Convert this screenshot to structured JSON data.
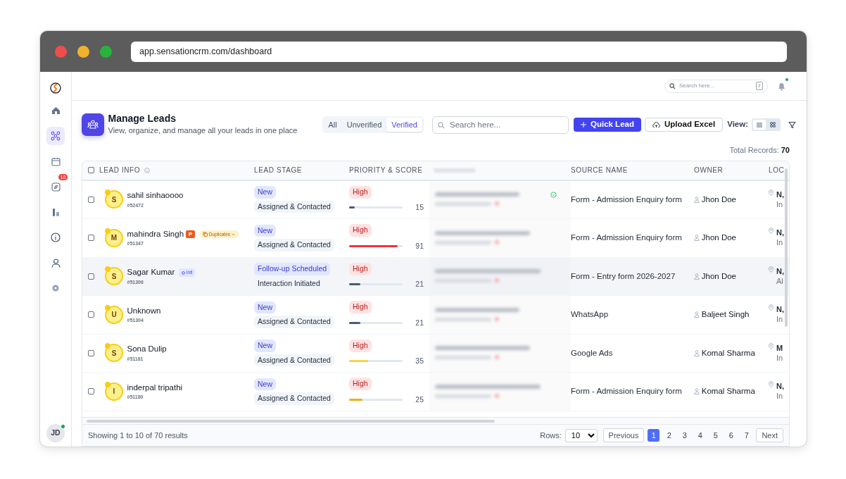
{
  "browser": {
    "url": "app.sensationcrm.com/dashboard"
  },
  "sidebar": {
    "items": [
      {
        "selected": false
      },
      {
        "selected": true
      },
      {
        "selected": false
      },
      {
        "selected": false,
        "badge": "10"
      },
      {
        "selected": false
      },
      {
        "selected": false
      },
      {
        "selected": false
      },
      {
        "selected": false
      }
    ],
    "avatar": "JD",
    "online": true
  },
  "topbar": {
    "search_placeholder": "Search here...",
    "shortcut": "/",
    "has_notification": true
  },
  "header": {
    "title": "Manage Leads",
    "subtitle": "View, organize, and manage all your leads in one place"
  },
  "filter_tabs": [
    {
      "label": "All",
      "selected": false
    },
    {
      "label": "Unverified",
      "selected": false
    },
    {
      "label": "Verified",
      "selected": true
    }
  ],
  "search": {
    "placeholder": "Search here..."
  },
  "buttons": {
    "quick_lead": "Quick Lead",
    "upload": "Upload Excel"
  },
  "view": {
    "label": "View:",
    "modes": [
      {
        "selected": true
      },
      {
        "selected": false
      }
    ]
  },
  "total": {
    "label": "Total Records:",
    "value": "70"
  },
  "table": {
    "all_checked": false,
    "columns": [
      "LEAD INFO",
      "LEAD STAGE",
      "PRIORITY & SCORE",
      "SOURCE NAME",
      "OWNER",
      "LOC"
    ],
    "rows": [
      {
        "checked": false,
        "initial": "S",
        "name": "sahil sinhaoooo",
        "id": "#52472",
        "tags": [],
        "stage": "New",
        "substage": "Assigned & Contacted",
        "priority": "High",
        "level": 0.11,
        "score": "15",
        "color": "#4b5a78",
        "verified": true,
        "highlighted": false,
        "source": "Form - Admission Enquiry form",
        "owner": "Jhon Doe",
        "location": [
          "N,",
          "In"
        ]
      },
      {
        "checked": false,
        "initial": "M",
        "name": "mahindra Singh",
        "id": "#51347",
        "tags": [
          {
            "kind": "priority",
            "text": "P"
          },
          {
            "kind": "duplicates",
            "text": "Duplicates"
          }
        ],
        "stage": "New",
        "substage": "Assigned & Contacted",
        "priority": "High",
        "level": 0.91,
        "score": "91",
        "color": "#ef3340",
        "verified": false,
        "highlighted": false,
        "source": "Form - Admission Enquiry form",
        "owner": "Jhon Doe",
        "location": [
          "N,",
          "In"
        ]
      },
      {
        "checked": false,
        "initial": "S",
        "name": "Sagar Kumar",
        "id": "#51306",
        "tags": [
          {
            "kind": "intl",
            "text": "Intl"
          }
        ],
        "stage": "Follow-up Scheduled",
        "substage": "Interaction Initiated",
        "priority": "High",
        "level": 0.21,
        "score": "21",
        "color": "#4b5a78",
        "verified": false,
        "highlighted": true,
        "source": "Form - Entry form 2026-2027",
        "owner": "Jhon Doe",
        "location": [
          "N,",
          "Al"
        ]
      },
      {
        "checked": false,
        "initial": "U",
        "name": "Unknown",
        "id": "#51304",
        "tags": [],
        "stage": "New",
        "substage": "Assigned & Contacted",
        "priority": "High",
        "level": 0.21,
        "score": "21",
        "color": "#4b5a78",
        "verified": false,
        "highlighted": false,
        "source": "WhatsApp",
        "owner": "Baljeet Singh",
        "location": [
          "N,",
          "In"
        ]
      },
      {
        "checked": false,
        "initial": "S",
        "name": "Sona Dulip",
        "id": "#51181",
        "tags": [],
        "stage": "New",
        "substage": "Assigned & Contacted",
        "priority": "High",
        "level": 0.35,
        "score": "35",
        "color": "#f5d547",
        "verified": false,
        "highlighted": false,
        "source": "Google Ads",
        "owner": "Komal Sharma",
        "location": [
          "M",
          "In"
        ]
      },
      {
        "checked": false,
        "initial": "I",
        "name": "inderpal tripathi",
        "id": "#51180",
        "tags": [],
        "stage": "New",
        "substage": "Assigned & Contacted",
        "priority": "High",
        "level": 0.25,
        "score": "25",
        "color": "#eab308",
        "verified": false,
        "highlighted": false,
        "source": "Form - Admission Enquiry form",
        "owner": "Komal Sharma",
        "location": [
          "N,",
          "In"
        ]
      }
    ]
  },
  "footer": {
    "summary": "Showing 1 to 10 of 70 results",
    "rows_label": "Rows:",
    "rows_value": "10",
    "previous": "Previous",
    "next": "Next",
    "pages": [
      {
        "label": "1",
        "selected": true
      },
      {
        "label": "2",
        "selected": false
      },
      {
        "label": "3",
        "selected": false
      },
      {
        "label": "4",
        "selected": false
      },
      {
        "label": "5",
        "selected": false
      },
      {
        "label": "6",
        "selected": false
      },
      {
        "label": "7",
        "selected": false
      }
    ]
  }
}
